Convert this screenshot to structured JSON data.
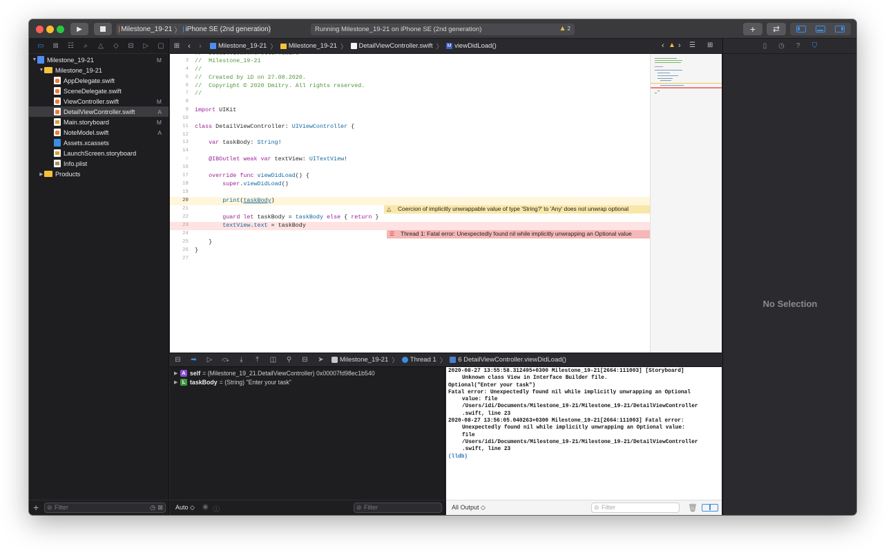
{
  "toolbar": {
    "scheme_target": "Milestone_19-21",
    "scheme_device": "iPhone SE (2nd generation)",
    "activity": "Running Milestone_19-21 on iPhone SE (2nd generation)",
    "warning_count": "2",
    "add_label": "+",
    "swap_label": "⇄"
  },
  "navigator": {
    "filter_placeholder": "Filter",
    "tree": [
      {
        "label": "Milestone_19-21",
        "badge": "M",
        "icon": "project-icon"
      },
      {
        "label": "Milestone_19-21",
        "badge": "",
        "icon": "folder-icon"
      },
      {
        "label": "AppDelegate.swift",
        "badge": "",
        "icon": "swift-file-icon"
      },
      {
        "label": "SceneDelegate.swift",
        "badge": "",
        "icon": "swift-file-icon"
      },
      {
        "label": "ViewController.swift",
        "badge": "M",
        "icon": "swift-file-icon"
      },
      {
        "label": "DetailViewController.swift",
        "badge": "A",
        "icon": "swift-file-icon"
      },
      {
        "label": "Main.storyboard",
        "badge": "M",
        "icon": "storyboard-file-icon"
      },
      {
        "label": "NoteModel.swift",
        "badge": "A",
        "icon": "swift-file-icon"
      },
      {
        "label": "Assets.xcassets",
        "badge": "",
        "icon": "assets-folder-icon"
      },
      {
        "label": "LaunchScreen.storyboard",
        "badge": "",
        "icon": "storyboard-file-icon"
      },
      {
        "label": "Info.plist",
        "badge": "",
        "icon": "plist-file-icon"
      },
      {
        "label": "Products",
        "badge": "",
        "icon": "folder-icon"
      }
    ]
  },
  "jumpbar": {
    "crumbs": [
      "Milestone_19-21",
      "Milestone_19-21",
      "DetailViewController.swift",
      "viewDidLoad()"
    ]
  },
  "editor": {
    "warning_message": "Coercion of implicitly unwrappable value of type 'String?' to 'Any' does not unwrap optional",
    "error_message": "Thread 1: Fatal error: Unexpectedly found nil while implicitly unwrapping an Optional value"
  },
  "debugbar": {
    "crumbs": [
      "Milestone_19-21",
      "Thread 1",
      "6 DetailViewController.viewDidLoad()"
    ]
  },
  "variables": {
    "rows": [
      {
        "badge": "A",
        "name": "self",
        "value": "= (Milestone_19_21.DetailViewController) 0x00007fd98ec1b540"
      },
      {
        "badge": "L",
        "name": "taskBody",
        "value": "= (String) \"Enter your task\""
      }
    ],
    "footer_mode": "Auto ◇",
    "filter_placeholder": "Filter"
  },
  "console": {
    "lines": [
      {
        "text": "2020-08-27 13:55:58.312495+0300 Milestone_19-21[2664:111003] [Storyboard]",
        "indent": false
      },
      {
        "text": "Unknown class View in Interface Builder file.",
        "indent": true
      },
      {
        "text": "Optional(\"Enter your task\")",
        "indent": false
      },
      {
        "text": "Fatal error: Unexpectedly found nil while implicitly unwrapping an Optional",
        "indent": false
      },
      {
        "text": "value: file",
        "indent": true
      },
      {
        "text": "/Users/idi/Documents/Milestone_19-21/Milestone_19-21/DetailViewController",
        "indent": true
      },
      {
        "text": ".swift, line 23",
        "indent": true
      },
      {
        "text": "2020-08-27 13:56:05.040263+0300 Milestone_19-21[2664:111003] Fatal error:",
        "indent": false
      },
      {
        "text": "Unexpectedly found nil while implicitly unwrapping an Optional value:",
        "indent": true
      },
      {
        "text": "file",
        "indent": true
      },
      {
        "text": "/Users/idi/Documents/Milestone_19-21/Milestone_19-21/DetailViewController",
        "indent": true
      },
      {
        "text": ".swift, line 23",
        "indent": true
      }
    ],
    "prompt": "(lldb)",
    "output_selector": "All Output ◇",
    "filter_placeholder": "Filter"
  },
  "inspector": {
    "empty_label": "No Selection"
  },
  "colors": {
    "accent": "#3a8ee6",
    "warning_bg": "#f8e7a8",
    "error_bg": "#f5b7b7"
  }
}
